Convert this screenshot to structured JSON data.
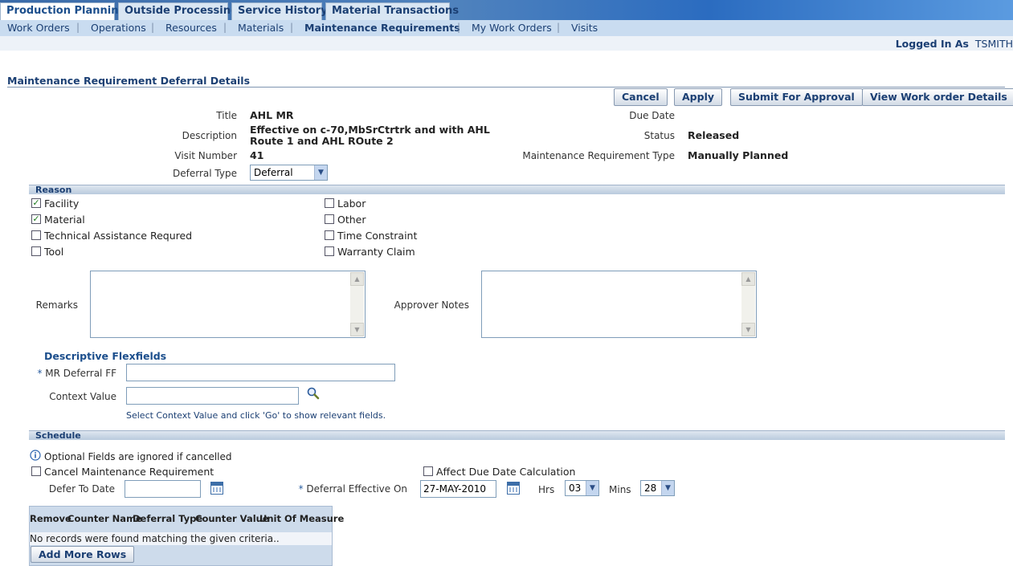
{
  "tabs": [
    {
      "label": "Production Planning",
      "active": true
    },
    {
      "label": "Outside Processing"
    },
    {
      "label": "Service History"
    },
    {
      "label": "Material Transactions"
    }
  ],
  "subnav": [
    "Work Orders",
    "Operations",
    "Resources",
    "Materials",
    "Maintenance Requirements",
    "My Work Orders",
    "Visits"
  ],
  "subnav_active": "Maintenance Requirements",
  "user": {
    "label": "Logged In As",
    "name": "TSMITH"
  },
  "page_title": "Maintenance Requirement Deferral Details",
  "buttons": {
    "cancel": "Cancel",
    "apply": "Apply",
    "submit": "Submit For Approval",
    "view": "View Work order Details"
  },
  "header_fields": {
    "title_label": "Title",
    "title_value": "AHL MR",
    "desc_label": "Description",
    "desc_line1": "Effective on c-70,MbSrCtrtrk and with AHL",
    "desc_line2": "Route 1 and AHL ROute 2",
    "visit_label": "Visit Number",
    "visit_value": "41",
    "deferral_type_label": "Deferral Type",
    "deferral_type_value": "Deferral",
    "due_date_label": "Due Date",
    "status_label": "Status",
    "status_value": "Released",
    "mr_type_label": "Maintenance Requirement Type",
    "mr_type_value": "Manually Planned"
  },
  "reason": {
    "title": "Reason",
    "items": [
      {
        "label": "Facility",
        "checked": true
      },
      {
        "label": "Material",
        "checked": true
      },
      {
        "label": "Technical Assistance Requred",
        "checked": false
      },
      {
        "label": "Tool",
        "checked": false
      },
      {
        "label": "Labor",
        "checked": false
      },
      {
        "label": "Other",
        "checked": false
      },
      {
        "label": "Time Constraint",
        "checked": false
      },
      {
        "label": "Warranty Claim",
        "checked": false
      }
    ]
  },
  "remarks_label": "Remarks",
  "approver_notes_label": "Approver Notes",
  "flex": {
    "title": "Descriptive Flexfields",
    "mr_deferral_ff_label": "MR Deferral FF",
    "context_label": "Context Value",
    "hint": "Select Context Value and click 'Go' to show relevant fields."
  },
  "schedule": {
    "title": "Schedule",
    "info": "Optional Fields are ignored if cancelled",
    "cancel_mr_label": "Cancel Maintenance Requirement",
    "affect_due_label": "Affect Due Date Calculation",
    "defer_to_label": "Defer To Date",
    "effective_label": "Deferral Effective On",
    "effective_value": "27-MAY-2010",
    "hrs_label": "Hrs",
    "hrs_value": "03",
    "mins_label": "Mins",
    "mins_value": "28"
  },
  "counter_table": {
    "columns": [
      "Remove",
      "Counter Name",
      "Deferral Type",
      "Counter Value",
      "Unit Of Measure"
    ],
    "empty_message": "No records were found matching the given criteria..",
    "add_rows_label": "Add More Rows"
  }
}
